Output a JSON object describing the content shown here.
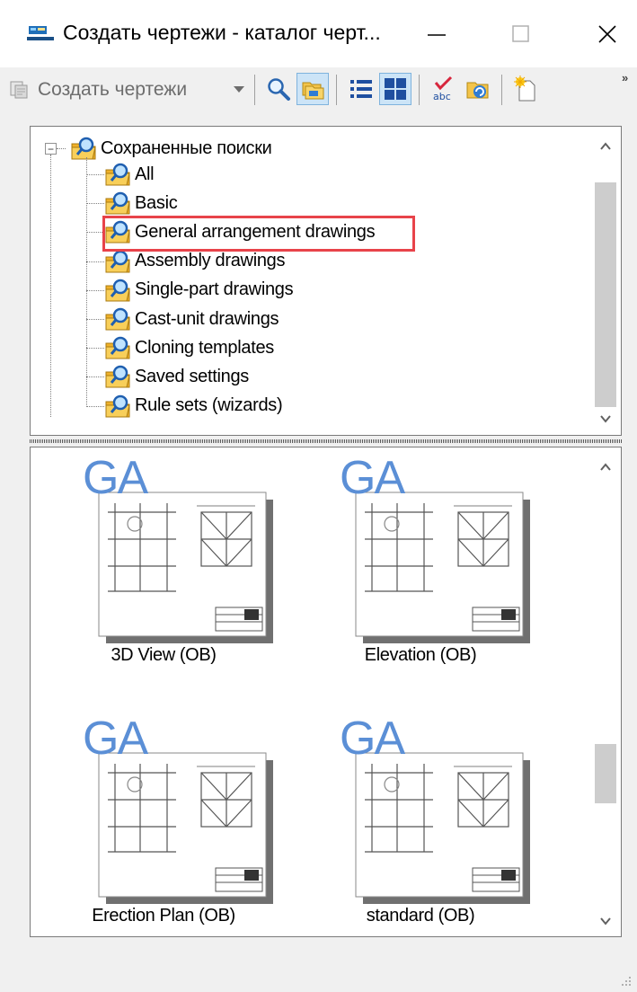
{
  "window": {
    "title": "Создать чертежи - каталог черт...",
    "controls": {
      "minimize": "—",
      "maximize": "☐",
      "close": "✕"
    }
  },
  "toolbar": {
    "create_drawings_label": "Создать чертежи",
    "buttons": [
      {
        "name": "search-icon"
      },
      {
        "name": "folders-icon",
        "active": true
      },
      {
        "name": "list-view-icon"
      },
      {
        "name": "thumbnail-view-icon",
        "active": true
      },
      {
        "name": "spellcheck-icon"
      },
      {
        "name": "refresh-folder-icon"
      },
      {
        "name": "new-item-icon"
      }
    ],
    "overflow": "»"
  },
  "tree": {
    "root_label": "Сохраненные поиски",
    "items": [
      {
        "label": "All"
      },
      {
        "label": "Basic"
      },
      {
        "label": "General arrangement drawings",
        "highlighted": true
      },
      {
        "label": "Assembly drawings"
      },
      {
        "label": "Single-part drawings"
      },
      {
        "label": "Cast-unit drawings"
      },
      {
        "label": "Cloning templates"
      },
      {
        "label": "Saved settings"
      },
      {
        "label": "Rule sets (wizards)"
      }
    ]
  },
  "thumbnails": {
    "badge": "GA",
    "items": [
      {
        "label": "3D View (OB)"
      },
      {
        "label": "Elevation (OB)"
      },
      {
        "label": "Erection Plan (OB)"
      },
      {
        "label": "standard (OB)"
      }
    ]
  },
  "colors": {
    "highlight_border": "#e8434a",
    "ga_badge": "#5b8fd6",
    "active_button": "#cce4f7"
  }
}
